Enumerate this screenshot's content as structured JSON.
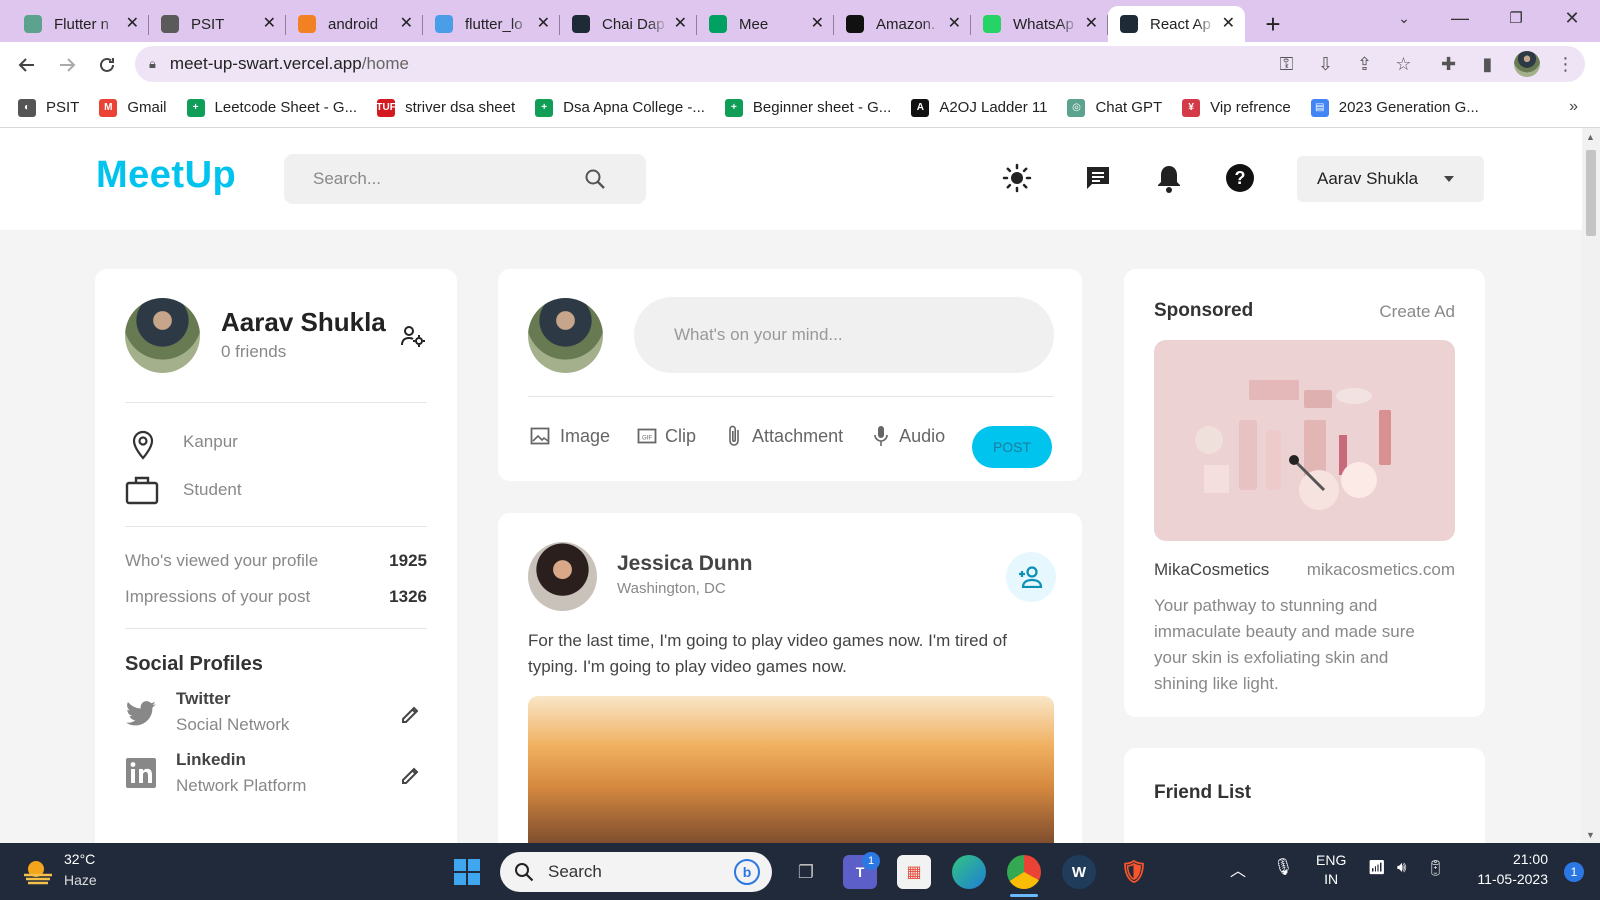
{
  "browser": {
    "tabs": [
      {
        "title": "Flutter n",
        "icon": "chatgpt-icon",
        "color": "#5ba38e"
      },
      {
        "title": "PSIT",
        "icon": "globe-icon",
        "color": "#5a5a5a"
      },
      {
        "title": "android",
        "icon": "stackoverflow-icon",
        "color": "#f48024"
      },
      {
        "title": "flutter_lo",
        "icon": "flutter-icon",
        "color": "#4a9ee8"
      },
      {
        "title": "Chai Dap",
        "icon": "react-icon",
        "color": "#1f2a37"
      },
      {
        "title": "Mee",
        "icon": "meet-icon",
        "color": "#00a162"
      },
      {
        "title": "Amazon.",
        "icon": "amazon-icon",
        "color": "#111111"
      },
      {
        "title": "WhatsAp",
        "icon": "whatsapp-icon",
        "color": "#25d366"
      },
      {
        "title": "React Ap",
        "icon": "react-icon",
        "color": "#1f2a37",
        "active": true
      }
    ],
    "url_host": "meet-up-swart.vercel.app",
    "url_path": "/home",
    "bookmarks": [
      {
        "label": "PSIT",
        "color": "#555555",
        "glyph": "◐"
      },
      {
        "label": "Gmail",
        "color": "#ea4335",
        "glyph": "M"
      },
      {
        "label": "Leetcode Sheet - G...",
        "color": "#0f9d58",
        "glyph": "+"
      },
      {
        "label": "striver dsa sheet",
        "color": "#d31a20",
        "glyph": "TUF"
      },
      {
        "label": "Dsa Apna College -...",
        "color": "#0f9d58",
        "glyph": "+"
      },
      {
        "label": "Beginner sheet - G...",
        "color": "#0f9d58",
        "glyph": "+"
      },
      {
        "label": "A2OJ Ladder 11",
        "color": "#111111",
        "glyph": "A"
      },
      {
        "label": "Chat GPT",
        "color": "#5ba38e",
        "glyph": "◎"
      },
      {
        "label": "Vip refrence",
        "color": "#d33b48",
        "glyph": "¥"
      },
      {
        "label": "2023 Generation G...",
        "color": "#4285f4",
        "glyph": "▤"
      }
    ]
  },
  "app": {
    "logo": "MeetUp",
    "search_placeholder": "Search...",
    "user_name": "Aarav Shukla",
    "accent": "#00c3ee"
  },
  "profile": {
    "name": "Aarav Shukla",
    "friends": "0 friends",
    "location": "Kanpur",
    "occupation": "Student",
    "viewed_label": "Who's viewed your profile",
    "viewed_value": "1925",
    "impressions_label": "Impressions of your post",
    "impressions_value": "1326",
    "social_heading": "Social Profiles",
    "socials": [
      {
        "name": "Twitter",
        "sub": "Social Network"
      },
      {
        "name": "Linkedin",
        "sub": "Network Platform"
      }
    ]
  },
  "composer": {
    "placeholder": "What's on your mind...",
    "actions": [
      "Image",
      "Clip",
      "Attachment",
      "Audio"
    ],
    "post_label": "POST"
  },
  "post": {
    "author": "Jessica Dunn",
    "location": "Washington, DC",
    "text": "For the last time, I'm going to play video games now. I'm tired of typing. I'm going to play video games now."
  },
  "sponsored": {
    "heading": "Sponsored",
    "create": "Create Ad",
    "brand": "MikaCosmetics",
    "site": "mikacosmetics.com",
    "desc": "Your pathway to stunning and immaculate beauty and made sure your skin is exfoliating skin and shining like light."
  },
  "friend_list": {
    "heading": "Friend List"
  },
  "taskbar": {
    "temp": "32°C",
    "weather": "Haze",
    "search": "Search",
    "lang1": "ENG",
    "lang2": "IN",
    "time": "21:00",
    "date": "11-05-2023",
    "notif_count": "1",
    "chat_badge": "1"
  }
}
